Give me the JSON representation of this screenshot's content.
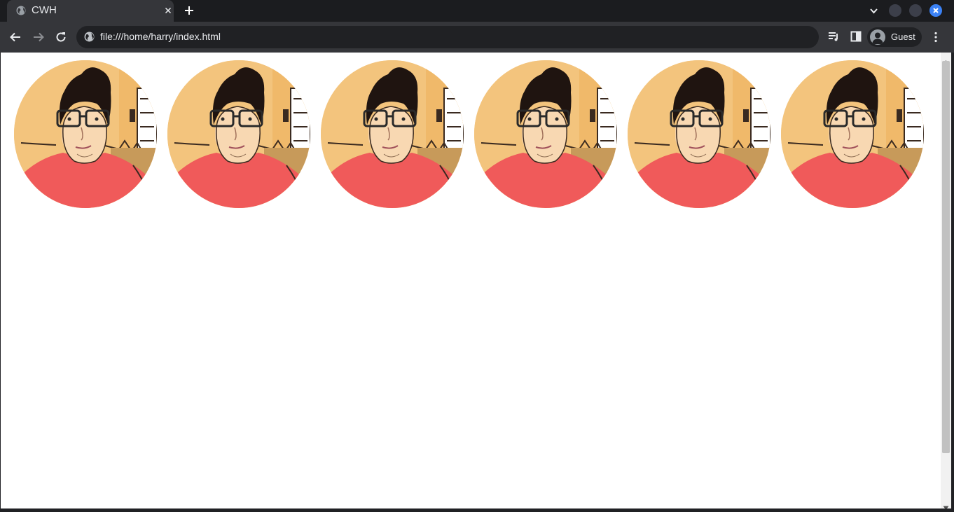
{
  "browser": {
    "tab": {
      "title": "CWH"
    },
    "address_bar": {
      "url": "file:///home/harry/index.html"
    },
    "profile": {
      "label": "Guest"
    }
  },
  "colors": {
    "tab_strip": "#1b1c1f",
    "toolbar": "#35363a",
    "omnibox": "#202124",
    "window_close": "#3b82f6",
    "page_background": "#ffffff"
  },
  "icons": {
    "tab_favicon": "globe-icon",
    "tab_close": "close-icon",
    "new_tab": "plus-icon",
    "tab_search": "chevron-down-icon",
    "back": "arrow-left-icon",
    "forward": "arrow-right-icon",
    "reload": "reload-icon",
    "site_info": "globe-icon",
    "media": "media-queue-icon",
    "side_panel": "side-panel-icon",
    "profile": "person-icon",
    "menu": "kebab-menu-icon"
  },
  "gallery": {
    "images": [
      {
        "subject": "cartoon portrait"
      },
      {
        "subject": "cartoon portrait"
      },
      {
        "subject": "cartoon portrait"
      },
      {
        "subject": "cartoon portrait"
      },
      {
        "subject": "cartoon portrait"
      },
      {
        "subject": "cartoon portrait"
      }
    ]
  }
}
